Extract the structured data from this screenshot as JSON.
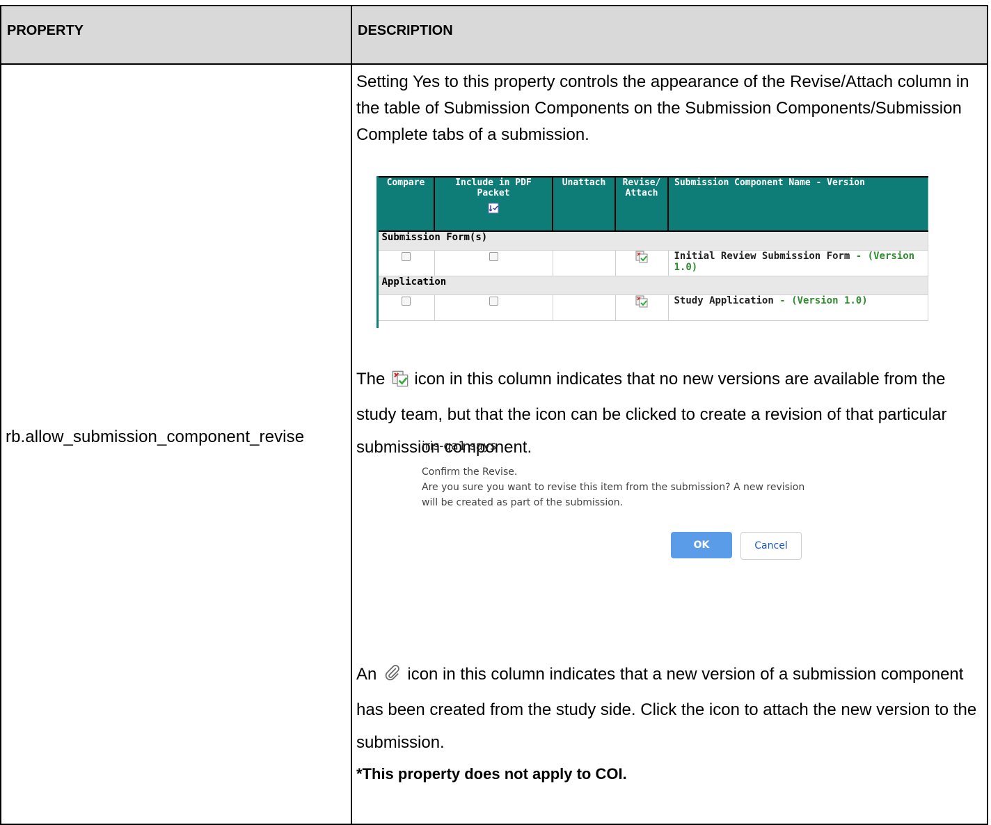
{
  "header": {
    "property": "PROPERTY",
    "description": "DESCRIPTION"
  },
  "row": {
    "property": "rb.allow_submission_component_revise",
    "p1": "Setting Yes to this property controls the appearance of the Revise/Attach column in the table of Submission Components on the Submission Components/Submission Complete tabs of a submission.",
    "p2_before": "The",
    "p2_after": "icon in this column indicates that no new versions are available from the study team, but that the icon can be clicked to create a revision of that particular submission component.",
    "p3_before": "An",
    "p3_after": "icon in this column indicates that a new version of a submission component has been created from the study side. Click the icon to attach the new version to the submission.",
    "p4": "*This property does not apply to COI."
  },
  "component_table": {
    "columns": [
      "Compare",
      "Include in PDF Packet",
      "Unattach",
      "Revise/ Attach",
      "Submission Component Name - Version"
    ],
    "groups": [
      {
        "name": "Submission Form(s)",
        "item": "Initial Review Submission Form",
        "version": "(Version 1.0)"
      },
      {
        "name": "Application",
        "item": "Study Application",
        "version": "(Version 1.0)"
      }
    ],
    "separator": " - ",
    "colors": {
      "header": "#0e7d78",
      "version": "#2e8b2e"
    }
  },
  "dialog": {
    "title": "iris-qa1 says",
    "line1": "Confirm the Revise.",
    "line2": " Are you sure you want to revise this item from the submission? A new revision will be created as part of the submission.",
    "ok": "OK",
    "cancel": "Cancel"
  }
}
